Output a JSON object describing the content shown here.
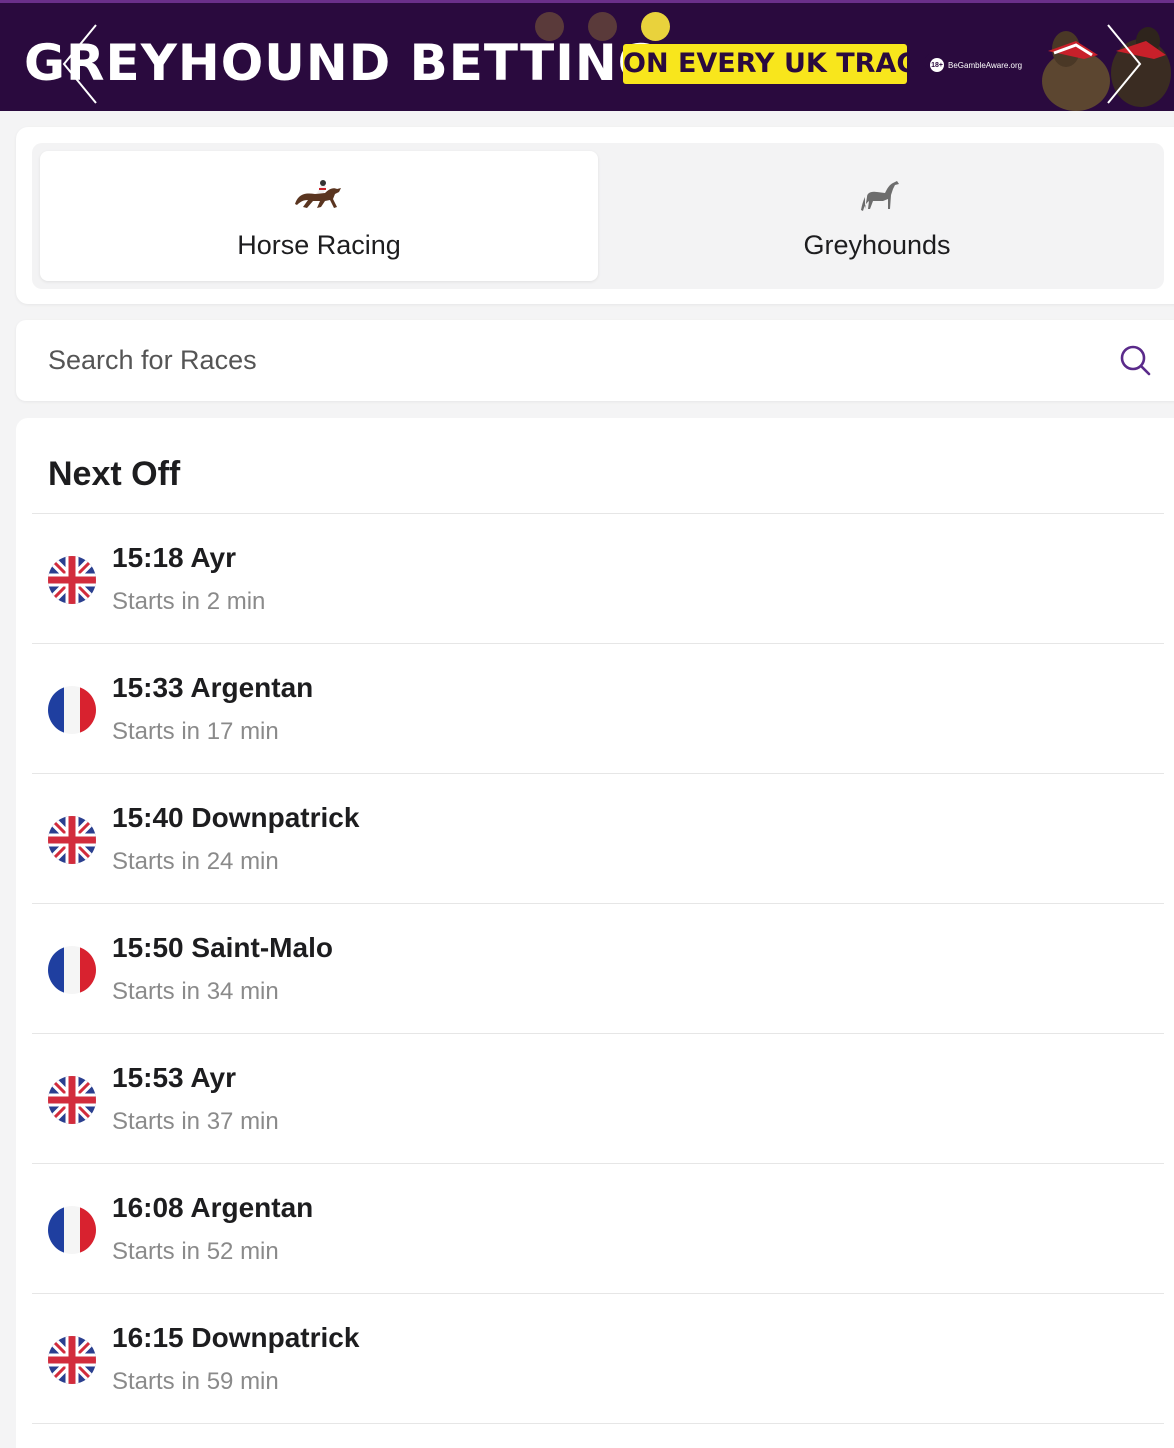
{
  "banner": {
    "title": "GREYHOUND BETTING",
    "tagline": "ON EVERY UK TRACK",
    "age_badge": "18+",
    "gamble_aware": "BeGambleAware.org",
    "brand_color": "#2a0a3e",
    "accent_color": "#f8e61c",
    "slides": 3,
    "active_slide": 3
  },
  "sport_tabs": {
    "horse_label": "Horse Racing",
    "greyhound_label": "Greyhounds",
    "horse_icon": "racehorse-jockey-icon",
    "greyhound_icon": "greyhound-icon",
    "selected": "Horse Racing"
  },
  "search": {
    "placeholder": "Search for Races",
    "value": "",
    "icon": "search-icon"
  },
  "next_off": {
    "title": "Next Off",
    "races": [
      {
        "name": "15:18 Ayr",
        "starts": "Starts in 2 min",
        "flag": "uk-flag-icon"
      },
      {
        "name": "15:33 Argentan",
        "starts": "Starts in 17 min",
        "flag": "france-flag-icon"
      },
      {
        "name": "15:40 Downpatrick",
        "starts": "Starts in 24 min",
        "flag": "uk-flag-icon"
      },
      {
        "name": "15:50 Saint-Malo",
        "starts": "Starts in 34 min",
        "flag": "france-flag-icon"
      },
      {
        "name": "15:53 Ayr",
        "starts": "Starts in 37 min",
        "flag": "uk-flag-icon"
      },
      {
        "name": "16:08 Argentan",
        "starts": "Starts in 52 min",
        "flag": "france-flag-icon"
      },
      {
        "name": "16:15 Downpatrick",
        "starts": "Starts in 59 min",
        "flag": "uk-flag-icon"
      }
    ]
  },
  "colors": {
    "primary_purple": "#5a2a8a",
    "muted_text": "#8a8a8a"
  }
}
